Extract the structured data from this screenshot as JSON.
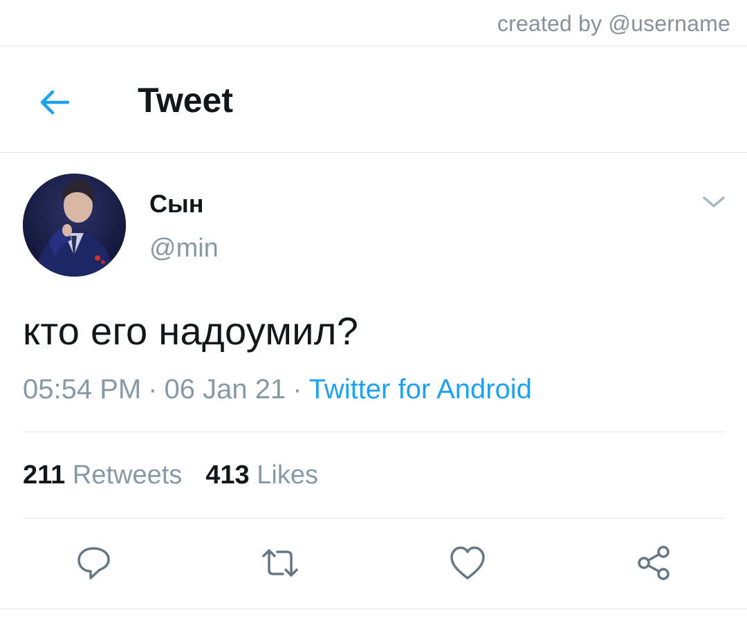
{
  "watermark": "created by @username",
  "header": {
    "back_icon": "arrow-left-icon",
    "title": "Tweet"
  },
  "tweet": {
    "author_name": "Сын",
    "author_handle": "@min",
    "text": "кто его надоумил?",
    "time": "05:54 PM",
    "date": "06 Jan 21",
    "separator": "·",
    "source": "Twitter for Android"
  },
  "stats": {
    "retweets_count": "211",
    "retweets_label": "Retweets",
    "likes_count": "413",
    "likes_label": "Likes"
  },
  "actions": [
    "reply-icon",
    "retweet-icon",
    "like-icon",
    "share-icon"
  ],
  "colors": {
    "accent": "#1da1f2",
    "muted": "#8899a6",
    "text": "#14171a",
    "divider": "#e1e8ed"
  }
}
